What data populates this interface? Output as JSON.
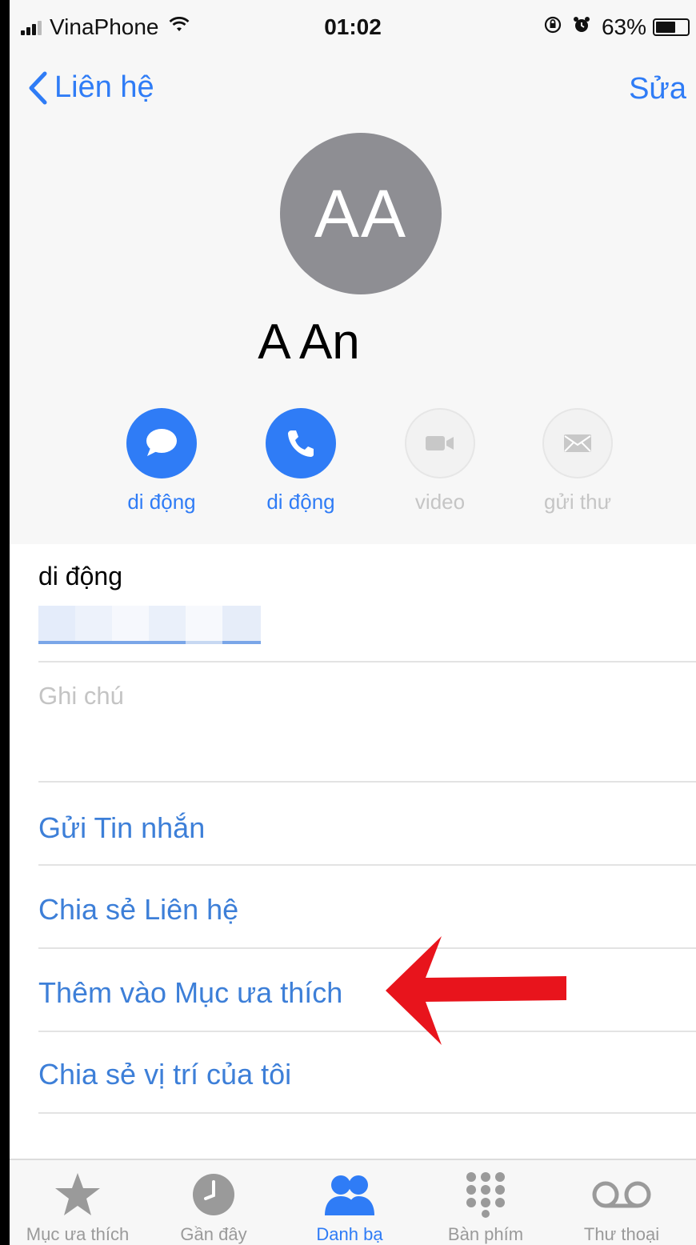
{
  "status_bar": {
    "carrier": "VinaPhone",
    "time": "01:02",
    "battery": "63%",
    "battery_level": 0.63
  },
  "nav": {
    "back_label": "Liên hệ",
    "edit_label": "Sửa"
  },
  "contact": {
    "initials": "AA",
    "name": "A An"
  },
  "actions": [
    {
      "label": "di động",
      "icon": "message-icon",
      "enabled": true
    },
    {
      "label": "di động",
      "icon": "phone-icon",
      "enabled": true
    },
    {
      "label": "video",
      "icon": "video-icon",
      "enabled": false
    },
    {
      "label": "gửi thư",
      "icon": "mail-icon",
      "enabled": false
    }
  ],
  "phone_field": {
    "label": "di động"
  },
  "notes": {
    "placeholder": "Ghi chú"
  },
  "links": [
    {
      "label": "Gửi Tin nhắn"
    },
    {
      "label": "Chia sẻ Liên hệ"
    },
    {
      "label": "Thêm vào Mục ưa thích"
    },
    {
      "label": "Chia sẻ vị trí của tôi"
    }
  ],
  "tabs": [
    {
      "label": "Mục ưa thích",
      "icon": "star-icon",
      "active": false
    },
    {
      "label": "Gần đây",
      "icon": "clock-icon",
      "active": false
    },
    {
      "label": "Danh bạ",
      "icon": "contacts-icon",
      "active": true
    },
    {
      "label": "Bàn phím",
      "icon": "keypad-icon",
      "active": false
    },
    {
      "label": "Thư thoại",
      "icon": "voicemail-icon",
      "active": false
    }
  ],
  "colors": {
    "accent": "#2f7cf6",
    "link": "#3d7fd8",
    "annotation": "#e8141c",
    "avatar": "#8e8e93"
  }
}
